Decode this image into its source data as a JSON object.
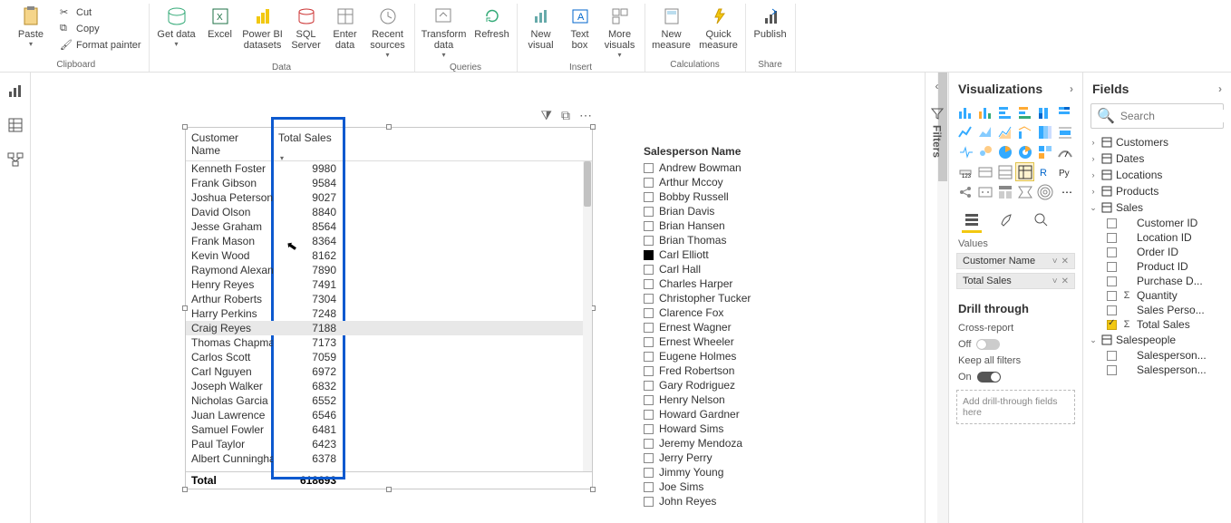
{
  "ribbon": {
    "clipboard": {
      "paste": "Paste",
      "cut": "Cut",
      "copy": "Copy",
      "format_painter": "Format painter",
      "group": "Clipboard"
    },
    "data": {
      "get_data": "Get data",
      "excel": "Excel",
      "pbi_datasets": "Power BI datasets",
      "sql": "SQL Server",
      "enter": "Enter data",
      "recent": "Recent sources",
      "group": "Data"
    },
    "queries": {
      "transform": "Transform data",
      "refresh": "Refresh",
      "group": "Queries"
    },
    "insert": {
      "new_visual": "New visual",
      "text_box": "Text box",
      "more": "More visuals",
      "group": "Insert"
    },
    "calc": {
      "new_measure": "New measure",
      "quick": "Quick measure",
      "group": "Calculations"
    },
    "share": {
      "publish": "Publish",
      "group": "Share"
    }
  },
  "filters_label": "Filters",
  "viz_pane": {
    "title": "Visualizations",
    "values_label": "Values",
    "wells": [
      "Customer Name",
      "Total Sales"
    ],
    "drill_title": "Drill through",
    "cross": "Cross-report",
    "off": "Off",
    "keep": "Keep all filters",
    "on": "On",
    "drill_hint": "Add drill-through fields here"
  },
  "fields_pane": {
    "title": "Fields",
    "search_ph": "Search",
    "tables": [
      {
        "name": "Customers",
        "open": false
      },
      {
        "name": "Dates",
        "open": false
      },
      {
        "name": "Locations",
        "open": false
      },
      {
        "name": "Products",
        "open": false
      },
      {
        "name": "Sales",
        "open": true,
        "fields": [
          {
            "name": "Customer ID",
            "checked": false
          },
          {
            "name": "Location ID",
            "checked": false
          },
          {
            "name": "Order ID",
            "checked": false
          },
          {
            "name": "Product ID",
            "checked": false
          },
          {
            "name": "Purchase D...",
            "checked": false
          },
          {
            "name": "Quantity",
            "checked": false,
            "sigma": true
          },
          {
            "name": "Sales Perso...",
            "checked": false
          },
          {
            "name": "Total Sales",
            "checked": true,
            "sigma": true
          }
        ]
      },
      {
        "name": "Salespeople",
        "open": true,
        "fields": [
          {
            "name": "Salesperson...",
            "checked": false
          },
          {
            "name": "Salesperson...",
            "checked": false
          }
        ]
      }
    ]
  },
  "chart_data": {
    "type": "table",
    "columns": [
      "Customer Name",
      "Total Sales"
    ],
    "rows": [
      [
        "Kenneth Foster",
        9980
      ],
      [
        "Frank Gibson",
        9584
      ],
      [
        "Joshua Peterson",
        9027
      ],
      [
        "David Olson",
        8840
      ],
      [
        "Jesse Graham",
        8564
      ],
      [
        "Frank Mason",
        8364
      ],
      [
        "Kevin Wood",
        8162
      ],
      [
        "Raymond Alexande",
        7890
      ],
      [
        "Henry Reyes",
        7491
      ],
      [
        "Arthur Roberts",
        7304
      ],
      [
        "Harry Perkins",
        7248
      ],
      [
        "Craig Reyes",
        7188
      ],
      [
        "Thomas Chapman",
        7173
      ],
      [
        "Carlos Scott",
        7059
      ],
      [
        "Carl Nguyen",
        6972
      ],
      [
        "Joseph Walker",
        6832
      ],
      [
        "Nicholas Garcia",
        6552
      ],
      [
        "Juan Lawrence",
        6546
      ],
      [
        "Samuel Fowler",
        6481
      ],
      [
        "Paul Taylor",
        6423
      ],
      [
        "Albert Cunningham",
        6378
      ]
    ],
    "total_label": "Total",
    "total": 618693,
    "highlight_row": 11
  },
  "slicer": {
    "title": "Salesperson Name",
    "items": [
      {
        "name": "Andrew Bowman",
        "c": false
      },
      {
        "name": "Arthur Mccoy",
        "c": false
      },
      {
        "name": "Bobby Russell",
        "c": false
      },
      {
        "name": "Brian Davis",
        "c": false
      },
      {
        "name": "Brian Hansen",
        "c": false
      },
      {
        "name": "Brian Thomas",
        "c": false
      },
      {
        "name": "Carl Elliott",
        "c": true
      },
      {
        "name": "Carl Hall",
        "c": false
      },
      {
        "name": "Charles Harper",
        "c": false
      },
      {
        "name": "Christopher Tucker",
        "c": false
      },
      {
        "name": "Clarence Fox",
        "c": false
      },
      {
        "name": "Ernest Wagner",
        "c": false
      },
      {
        "name": "Ernest Wheeler",
        "c": false
      },
      {
        "name": "Eugene Holmes",
        "c": false
      },
      {
        "name": "Fred Robertson",
        "c": false
      },
      {
        "name": "Gary Rodriguez",
        "c": false
      },
      {
        "name": "Henry Nelson",
        "c": false
      },
      {
        "name": "Howard Gardner",
        "c": false
      },
      {
        "name": "Howard Sims",
        "c": false
      },
      {
        "name": "Jeremy Mendoza",
        "c": false
      },
      {
        "name": "Jerry Perry",
        "c": false
      },
      {
        "name": "Jimmy Young",
        "c": false
      },
      {
        "name": "Joe Sims",
        "c": false
      },
      {
        "name": "John Reyes",
        "c": false
      }
    ]
  }
}
